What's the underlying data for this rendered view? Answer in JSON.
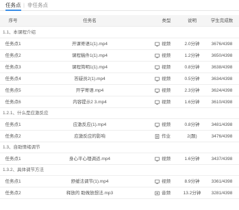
{
  "tabs": {
    "active": "任务点",
    "separator": "|",
    "other": "非任务点"
  },
  "columns": {
    "no": "序号",
    "name": "任务名",
    "type": "类型",
    "duration": "说明",
    "done": "学生完成数"
  },
  "sections": [
    {
      "title": "1.1、本课程介绍",
      "rows": [
        {
          "no": "任务点1",
          "name": "开课寄语1(1).mp4",
          "type": "视频",
          "icon": "video",
          "duration": "2.0分钟",
          "done": "3676/4398"
        },
        {
          "no": "任务点2",
          "name": "课程稿件1(1).mp4",
          "type": "视频",
          "icon": "video",
          "duration": "1.2分钟",
          "done": "3650/4398"
        },
        {
          "no": "任务点3",
          "name": "课程简明1(1).mp4",
          "type": "视频",
          "icon": "video",
          "duration": "0.8分钟",
          "done": "3638/4398"
        },
        {
          "no": "任务点4",
          "name": "答疑员2(1).mp4",
          "type": "视频",
          "icon": "video",
          "duration": "0.5分钟",
          "done": "3634/4398"
        },
        {
          "no": "任务点5",
          "name": "开学寄语.mp4",
          "type": "视频",
          "icon": "video",
          "duration": "2.3分钟",
          "done": "3624/4398"
        },
        {
          "no": "任务点6",
          "name": "内容提示2 3.mp4",
          "type": "视频",
          "icon": "video",
          "duration": "1.6分钟",
          "done": "3610/4398"
        }
      ]
    },
    {
      "title": "1.2.1、什么是应激反应",
      "rows": [
        {
          "no": "任务点1",
          "name": "应激反应(1).mp4",
          "type": "视频",
          "icon": "video",
          "duration": "0.8分钟",
          "done": "3481/4398"
        },
        {
          "no": "任务点2",
          "name": "应激反应的影响",
          "type": "作业",
          "icon": "homework",
          "duration": "2(题)",
          "done": "3476/4398"
        }
      ]
    },
    {
      "title": "1.3、自助情绪调节",
      "rows": [
        {
          "no": "任务点1",
          "name": "身心平心理调适.mp4",
          "type": "视频",
          "icon": "video",
          "duration": "1.6分钟",
          "done": "3437/4398"
        }
      ]
    },
    {
      "title": "1.3.2、具体调节方法",
      "rows": [
        {
          "no": "任务点1",
          "name": "舒缓法调节(1).mp4",
          "type": "视频",
          "icon": "video",
          "duration": "8.9分钟",
          "done": "3361/4398"
        },
        {
          "no": "任务点2",
          "name": "释放的 助做放想法.mp3",
          "type": "音频",
          "icon": "audio",
          "duration": "13.2分钟",
          "done": "3281/4398"
        }
      ]
    }
  ],
  "colors": {
    "accent": "#3a8ee6",
    "header_bg": "#f5f5f5",
    "border": "#eeeeee"
  }
}
